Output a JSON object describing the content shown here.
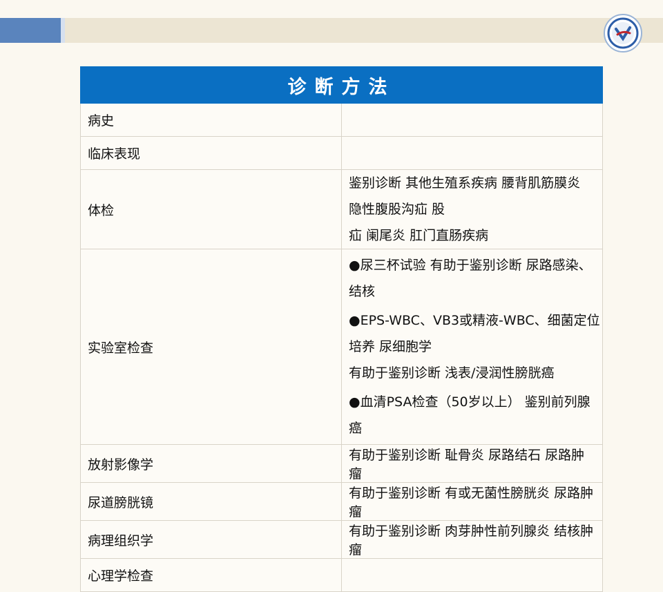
{
  "slide": {
    "title": "诊断方法",
    "rows": [
      {
        "category": "病史",
        "lines": []
      },
      {
        "category": "临床表现",
        "lines": []
      },
      {
        "category": "体检",
        "lines": [
          "鉴别诊断  其他生殖系疾病 腰背肌筋膜炎 隐性腹股沟疝  股",
          "疝 阑尾炎 肛门直肠疾病"
        ]
      },
      {
        "category": "实验室检查",
        "lines": [
          "●尿三杯试验  有助于鉴别诊断 尿路感染、结核",
          "●EPS-WBC、VB3或精液-WBC、细菌定位培养 尿细胞学",
          "有助于鉴别诊断 浅表/浸润性膀胱癌",
          "●血清PSA检查（50岁以上） 鉴别前列腺癌"
        ]
      },
      {
        "category": "放射影像学",
        "lines": [
          "有助于鉴别诊断 耻骨炎 尿路结石 尿路肿瘤"
        ]
      },
      {
        "category": "尿道膀胱镜",
        "lines": [
          "有助于鉴别诊断 有或无菌性膀胱炎 尿路肿瘤"
        ]
      },
      {
        "category": "病理组织学",
        "lines": [
          "有助于鉴别诊断 肉芽肿性前列腺炎 结核肿瘤"
        ]
      },
      {
        "category": "心理学检查",
        "lines": []
      }
    ]
  }
}
